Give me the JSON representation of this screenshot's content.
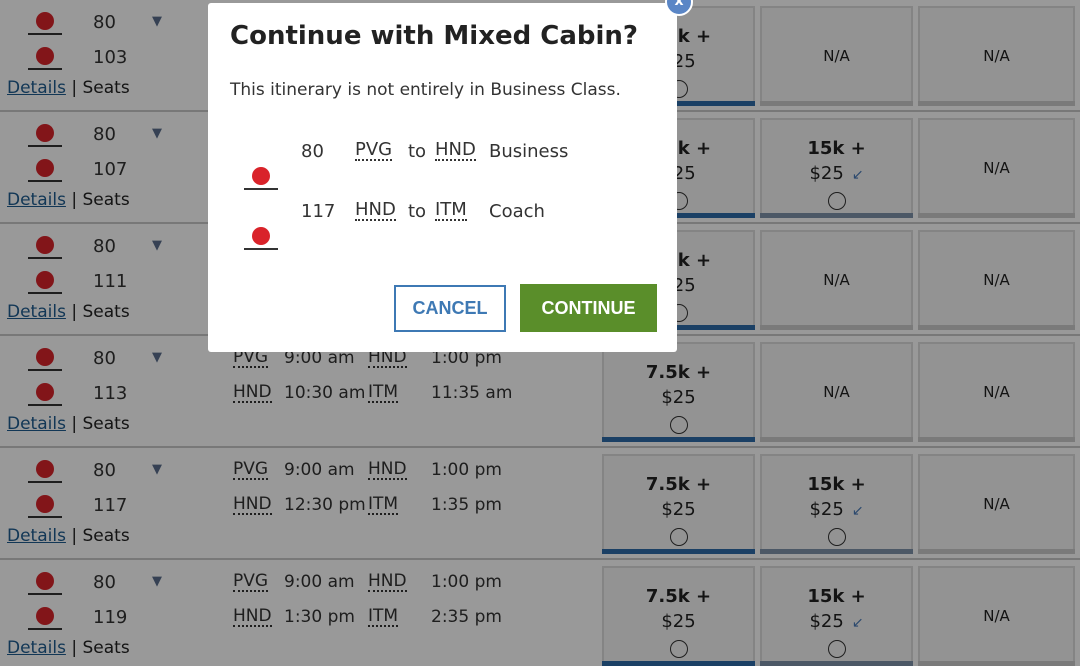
{
  "colors": {
    "accent_blue": "#2e6ca8",
    "continue_green": "#5a8e2a",
    "jal_red": "#d9232a"
  },
  "icons": {
    "wifi": "wifi-icon",
    "seat": "seat-icon",
    "airline": "japan-airlines-logo",
    "close": "close-icon"
  },
  "links": {
    "details": "Details",
    "separator": "|",
    "seats": "Seats"
  },
  "rows": [
    {
      "flights": [
        "80",
        "103"
      ],
      "segments": [],
      "fares": [
        {
          "miles": "7.5k +",
          "price": "$25"
        },
        null,
        null
      ]
    },
    {
      "flights": [
        "80",
        "107"
      ],
      "segments": [],
      "fares": [
        {
          "miles": "7.5k +",
          "price": "$25"
        },
        {
          "miles": "15k +",
          "price": "$25",
          "seat": true
        },
        null
      ]
    },
    {
      "flights": [
        "80",
        "111"
      ],
      "segments": [],
      "fares": [
        {
          "miles": "7.5k +",
          "price": "$25"
        },
        null,
        null
      ]
    },
    {
      "flights": [
        "80",
        "113"
      ],
      "segments": [
        [
          "PVG",
          "9:00 am",
          "HND",
          "1:00 pm"
        ],
        [
          "HND",
          "10:30 am",
          "ITM",
          "11:35 am"
        ]
      ],
      "fares": [
        {
          "miles": "7.5k +",
          "price": "$25"
        },
        null,
        null
      ]
    },
    {
      "flights": [
        "80",
        "117"
      ],
      "segments": [
        [
          "PVG",
          "9:00 am",
          "HND",
          "1:00 pm"
        ],
        [
          "HND",
          "12:30 pm",
          "ITM",
          "1:35 pm"
        ]
      ],
      "fares": [
        {
          "miles": "7.5k +",
          "price": "$25"
        },
        {
          "miles": "15k +",
          "price": "$25",
          "seat": true
        },
        null
      ]
    },
    {
      "flights": [
        "80",
        "119"
      ],
      "segments": [
        [
          "PVG",
          "9:00 am",
          "HND",
          "1:00 pm"
        ],
        [
          "HND",
          "1:30 pm",
          "ITM",
          "2:35 pm"
        ]
      ],
      "fares": [
        {
          "miles": "7.5k +",
          "price": "$25"
        },
        {
          "miles": "15k +",
          "price": "$25",
          "seat": true
        },
        null
      ]
    }
  ],
  "na_label": "N/A",
  "modal": {
    "title": "Continue with Mixed Cabin?",
    "subtitle": "This itinerary is not entirely in Business Class.",
    "close_label": "x",
    "segments": [
      {
        "flight": "80",
        "from": "PVG",
        "to_word": "to",
        "to": "HND",
        "cabin": "Business"
      },
      {
        "flight": "117",
        "from": "HND",
        "to_word": "to",
        "to": "ITM",
        "cabin": "Coach"
      }
    ],
    "cancel_label": "CANCEL",
    "continue_label": "CONTINUE"
  }
}
